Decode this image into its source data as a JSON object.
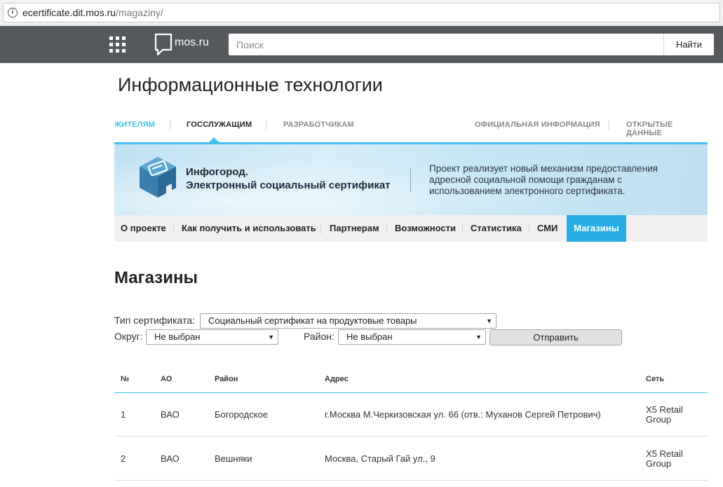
{
  "browser": {
    "url_domain": "ecertificate.dit.mos.ru",
    "url_path": "/magaziny/"
  },
  "header": {
    "logo_text": "mos.ru",
    "search_placeholder": "Поиск",
    "search_button": "Найти"
  },
  "site": {
    "title": "Информационные технологии"
  },
  "topnav": {
    "items": [
      {
        "label": "ЖИТЕЛЯМ",
        "color": "#3ec1ea"
      },
      {
        "label": "ГОССЛУЖАЩИМ",
        "color": "#222222"
      },
      {
        "label": "РАЗРАБОТЧИКАМ",
        "color": "#888888"
      },
      {
        "label": "ОФИЦИАЛЬНАЯ ИНФОРМАЦИЯ",
        "color": "#888888"
      },
      {
        "label": "ОТКРЫТЫЕ ДАННЫЕ",
        "color": "#888888"
      }
    ]
  },
  "banner": {
    "title_line1": "Инфогород.",
    "title_line2": "Электронный социальный сертификат",
    "description": "Проект реализует новый механизм предоставления адресной социальной помощи гражданам с использованием электронного сертификата."
  },
  "subnav": {
    "items": [
      {
        "label": "О проекте"
      },
      {
        "label": "Как получить и использовать"
      },
      {
        "label": "Партнерам"
      },
      {
        "label": "Возможности"
      },
      {
        "label": "Статистика"
      },
      {
        "label": "СМИ"
      },
      {
        "label": "Магазины",
        "active": true
      }
    ]
  },
  "page": {
    "title": "Магазины"
  },
  "filters": {
    "cert_type_label": "Тип сертификата:",
    "cert_type_value": "Социальный сертификат на продуктовые товары",
    "district_label": "Округ:",
    "district_value": "Не выбран",
    "area_label": "Район:",
    "area_value": "Не выбран",
    "submit_label": "Отправить"
  },
  "table": {
    "headers": {
      "num": "№",
      "ao": "АО",
      "area": "Район",
      "address": "Адрес",
      "network": "Сеть"
    },
    "rows": [
      {
        "num": "1",
        "ao": "ВАО",
        "area": "Богородское",
        "address": "г.Москва М.Черкизовская ул. 66 (отв.: Муханов Сергей Петрович)",
        "network_1": "X5 Retail",
        "network_2": "Group"
      },
      {
        "num": "2",
        "ao": "ВАО",
        "area": "Вешняки",
        "address": "Москва, Старый Гай ул., 9",
        "network_1": "X5 Retail",
        "network_2": "Group"
      }
    ]
  },
  "colors": {
    "accent": "#3ec1ea",
    "active_tab": "#28aee4",
    "header_bg": "#55585c"
  }
}
